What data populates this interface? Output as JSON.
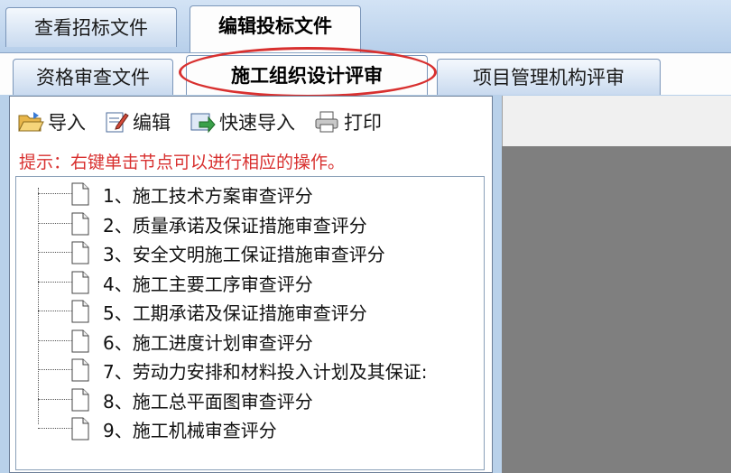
{
  "top_tabs": [
    {
      "label": "查看招标文件",
      "active": false
    },
    {
      "label": "编辑投标文件",
      "active": true
    }
  ],
  "sub_tabs": [
    {
      "label": "资格审查文件",
      "active": false
    },
    {
      "label": "施工组织设计评审",
      "active": true
    },
    {
      "label": "项目管理机构评审",
      "active": false
    }
  ],
  "toolbar": {
    "import_label": "导入",
    "edit_label": "编辑",
    "quick_import_label": "快速导入",
    "print_label": "打印"
  },
  "hint": "提示：右键单击节点可以进行相应的操作。",
  "tree": {
    "items": [
      {
        "label": "1、施工技术方案审查评分"
      },
      {
        "label": "2、质量承诺及保证措施审查评分"
      },
      {
        "label": "3、安全文明施工保证措施审查评分"
      },
      {
        "label": "4、施工主要工序审查评分"
      },
      {
        "label": "5、工期承诺及保证措施审查评分"
      },
      {
        "label": "6、施工进度计划审查评分"
      },
      {
        "label": "7、劳动力安排和材料投入计划及其保证:"
      },
      {
        "label": "8、施工总平面图审查评分"
      },
      {
        "label": "9、施工机械审查评分"
      }
    ]
  },
  "colors": {
    "hint_red": "#d8302f",
    "highlight_red": "#d8302f",
    "window_blue": "#b9d1ea"
  }
}
